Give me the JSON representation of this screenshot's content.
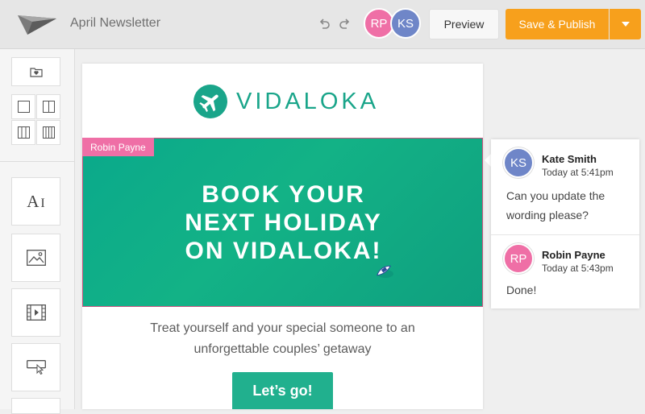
{
  "app": {
    "document_title": "April Newsletter",
    "logo_icon": "paper-plane-logo-icon",
    "undo_icon": "undo-icon",
    "redo_icon": "redo-icon"
  },
  "collaborators": [
    {
      "initials": "RP",
      "color": "#ef6fa6"
    },
    {
      "initials": "KS",
      "color": "#6f86c8"
    }
  ],
  "toolbar": {
    "preview_label": "Preview",
    "publish_label": "Save & Publish",
    "publish_color": "#f7a01c",
    "dropdown_icon": "caret-down-icon"
  },
  "sidebar": {
    "items": [
      {
        "icon": "folder-heart-icon"
      },
      {
        "icon": "layout-1-column-icon"
      },
      {
        "icon": "layout-2-column-icon"
      },
      {
        "icon": "layout-3-column-icon"
      },
      {
        "icon": "layout-4-column-icon"
      },
      {
        "icon": "text-block-icon",
        "label": "A"
      },
      {
        "icon": "image-block-icon"
      },
      {
        "icon": "video-block-icon"
      },
      {
        "icon": "button-block-icon"
      }
    ]
  },
  "email": {
    "brand_name": "VIDALOKA",
    "brand_icon": "airplane-icon",
    "brand_color": "#1aa58a",
    "hero_lines": [
      "BOOK YOUR",
      "NEXT HOLIDAY",
      "ON VIDALOKA!"
    ],
    "editing_tag": "Robin Payne",
    "body_lines": [
      "Treat yourself and your special someone to an",
      "unforgettable couples’ getaway"
    ],
    "cta_label": "Let’s go!"
  },
  "comments": [
    {
      "initials": "KS",
      "name": "Kate Smith",
      "time": "Today at 5:41pm",
      "text_lines": [
        "Can you update the",
        "wording please?"
      ]
    },
    {
      "initials": "RP",
      "name": "Robin Payne",
      "time": "Today at 5:43pm",
      "text_lines": [
        "Done!"
      ]
    }
  ]
}
